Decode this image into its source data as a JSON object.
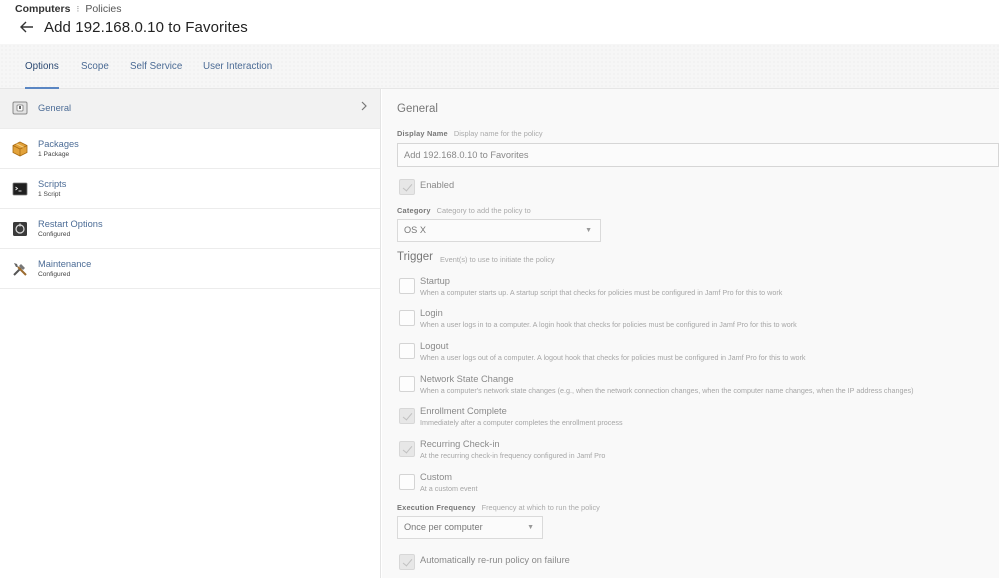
{
  "breadcrumb": {
    "root": "Computers",
    "separator": "⁝",
    "child": "Policies"
  },
  "page": {
    "title": "Add 192.168.0.10 to Favorites"
  },
  "tabs": [
    {
      "label": "Options",
      "active": true
    },
    {
      "label": "Scope",
      "active": false
    },
    {
      "label": "Self Service",
      "active": false
    },
    {
      "label": "User Interaction",
      "active": false
    }
  ],
  "sidebar": {
    "items": [
      {
        "label": "General",
        "sub": "",
        "icon": "general-icon",
        "active": true
      },
      {
        "label": "Packages",
        "sub": "1 Package",
        "icon": "package-icon",
        "active": false
      },
      {
        "label": "Scripts",
        "sub": "1 Script",
        "icon": "terminal-icon",
        "active": false
      },
      {
        "label": "Restart Options",
        "sub": "Configured",
        "icon": "restart-icon",
        "active": false
      },
      {
        "label": "Maintenance",
        "sub": "Configured",
        "icon": "tools-icon",
        "active": false
      }
    ]
  },
  "general": {
    "title": "General",
    "display_name": {
      "label": "Display Name",
      "hint": "Display name for the policy",
      "value": "Add 192.168.0.10 to Favorites"
    },
    "enabled": {
      "label": "Enabled",
      "checked": true
    },
    "category": {
      "label": "Category",
      "hint": "Category to add the policy to",
      "value": "OS X"
    },
    "trigger": {
      "title": "Trigger",
      "hint": "Event(s) to use to initiate the policy",
      "items": [
        {
          "label": "Startup",
          "desc": "When a computer starts up. A startup script that checks for policies must be configured in Jamf Pro for this to work",
          "checked": false
        },
        {
          "label": "Login",
          "desc": "When a user logs in to a computer. A login hook that checks for policies must be configured in Jamf Pro for this to work",
          "checked": false
        },
        {
          "label": "Logout",
          "desc": "When a user logs out of a computer. A logout hook that checks for policies must be configured in Jamf Pro for this to work",
          "checked": false
        },
        {
          "label": "Network State Change",
          "desc": "When a computer's network state changes (e.g., when the network connection changes, when the computer name changes, when the IP address changes)",
          "checked": false
        },
        {
          "label": "Enrollment Complete",
          "desc": "Immediately after a computer completes the enrollment process",
          "checked": true
        },
        {
          "label": "Recurring Check-in",
          "desc": "At the recurring check-in frequency configured in Jamf Pro",
          "checked": true
        },
        {
          "label": "Custom",
          "desc": "At a custom event",
          "checked": false
        }
      ]
    },
    "execution_frequency": {
      "label": "Execution Frequency",
      "hint": "Frequency at which to run the policy",
      "value": "Once per computer"
    },
    "rerun": {
      "label": "Automatically re-run policy on failure",
      "checked": true
    }
  },
  "colors": {
    "link": "#4c6c96",
    "tab_underline": "#5a86c3",
    "panel_bg": "#f9f9f9"
  }
}
